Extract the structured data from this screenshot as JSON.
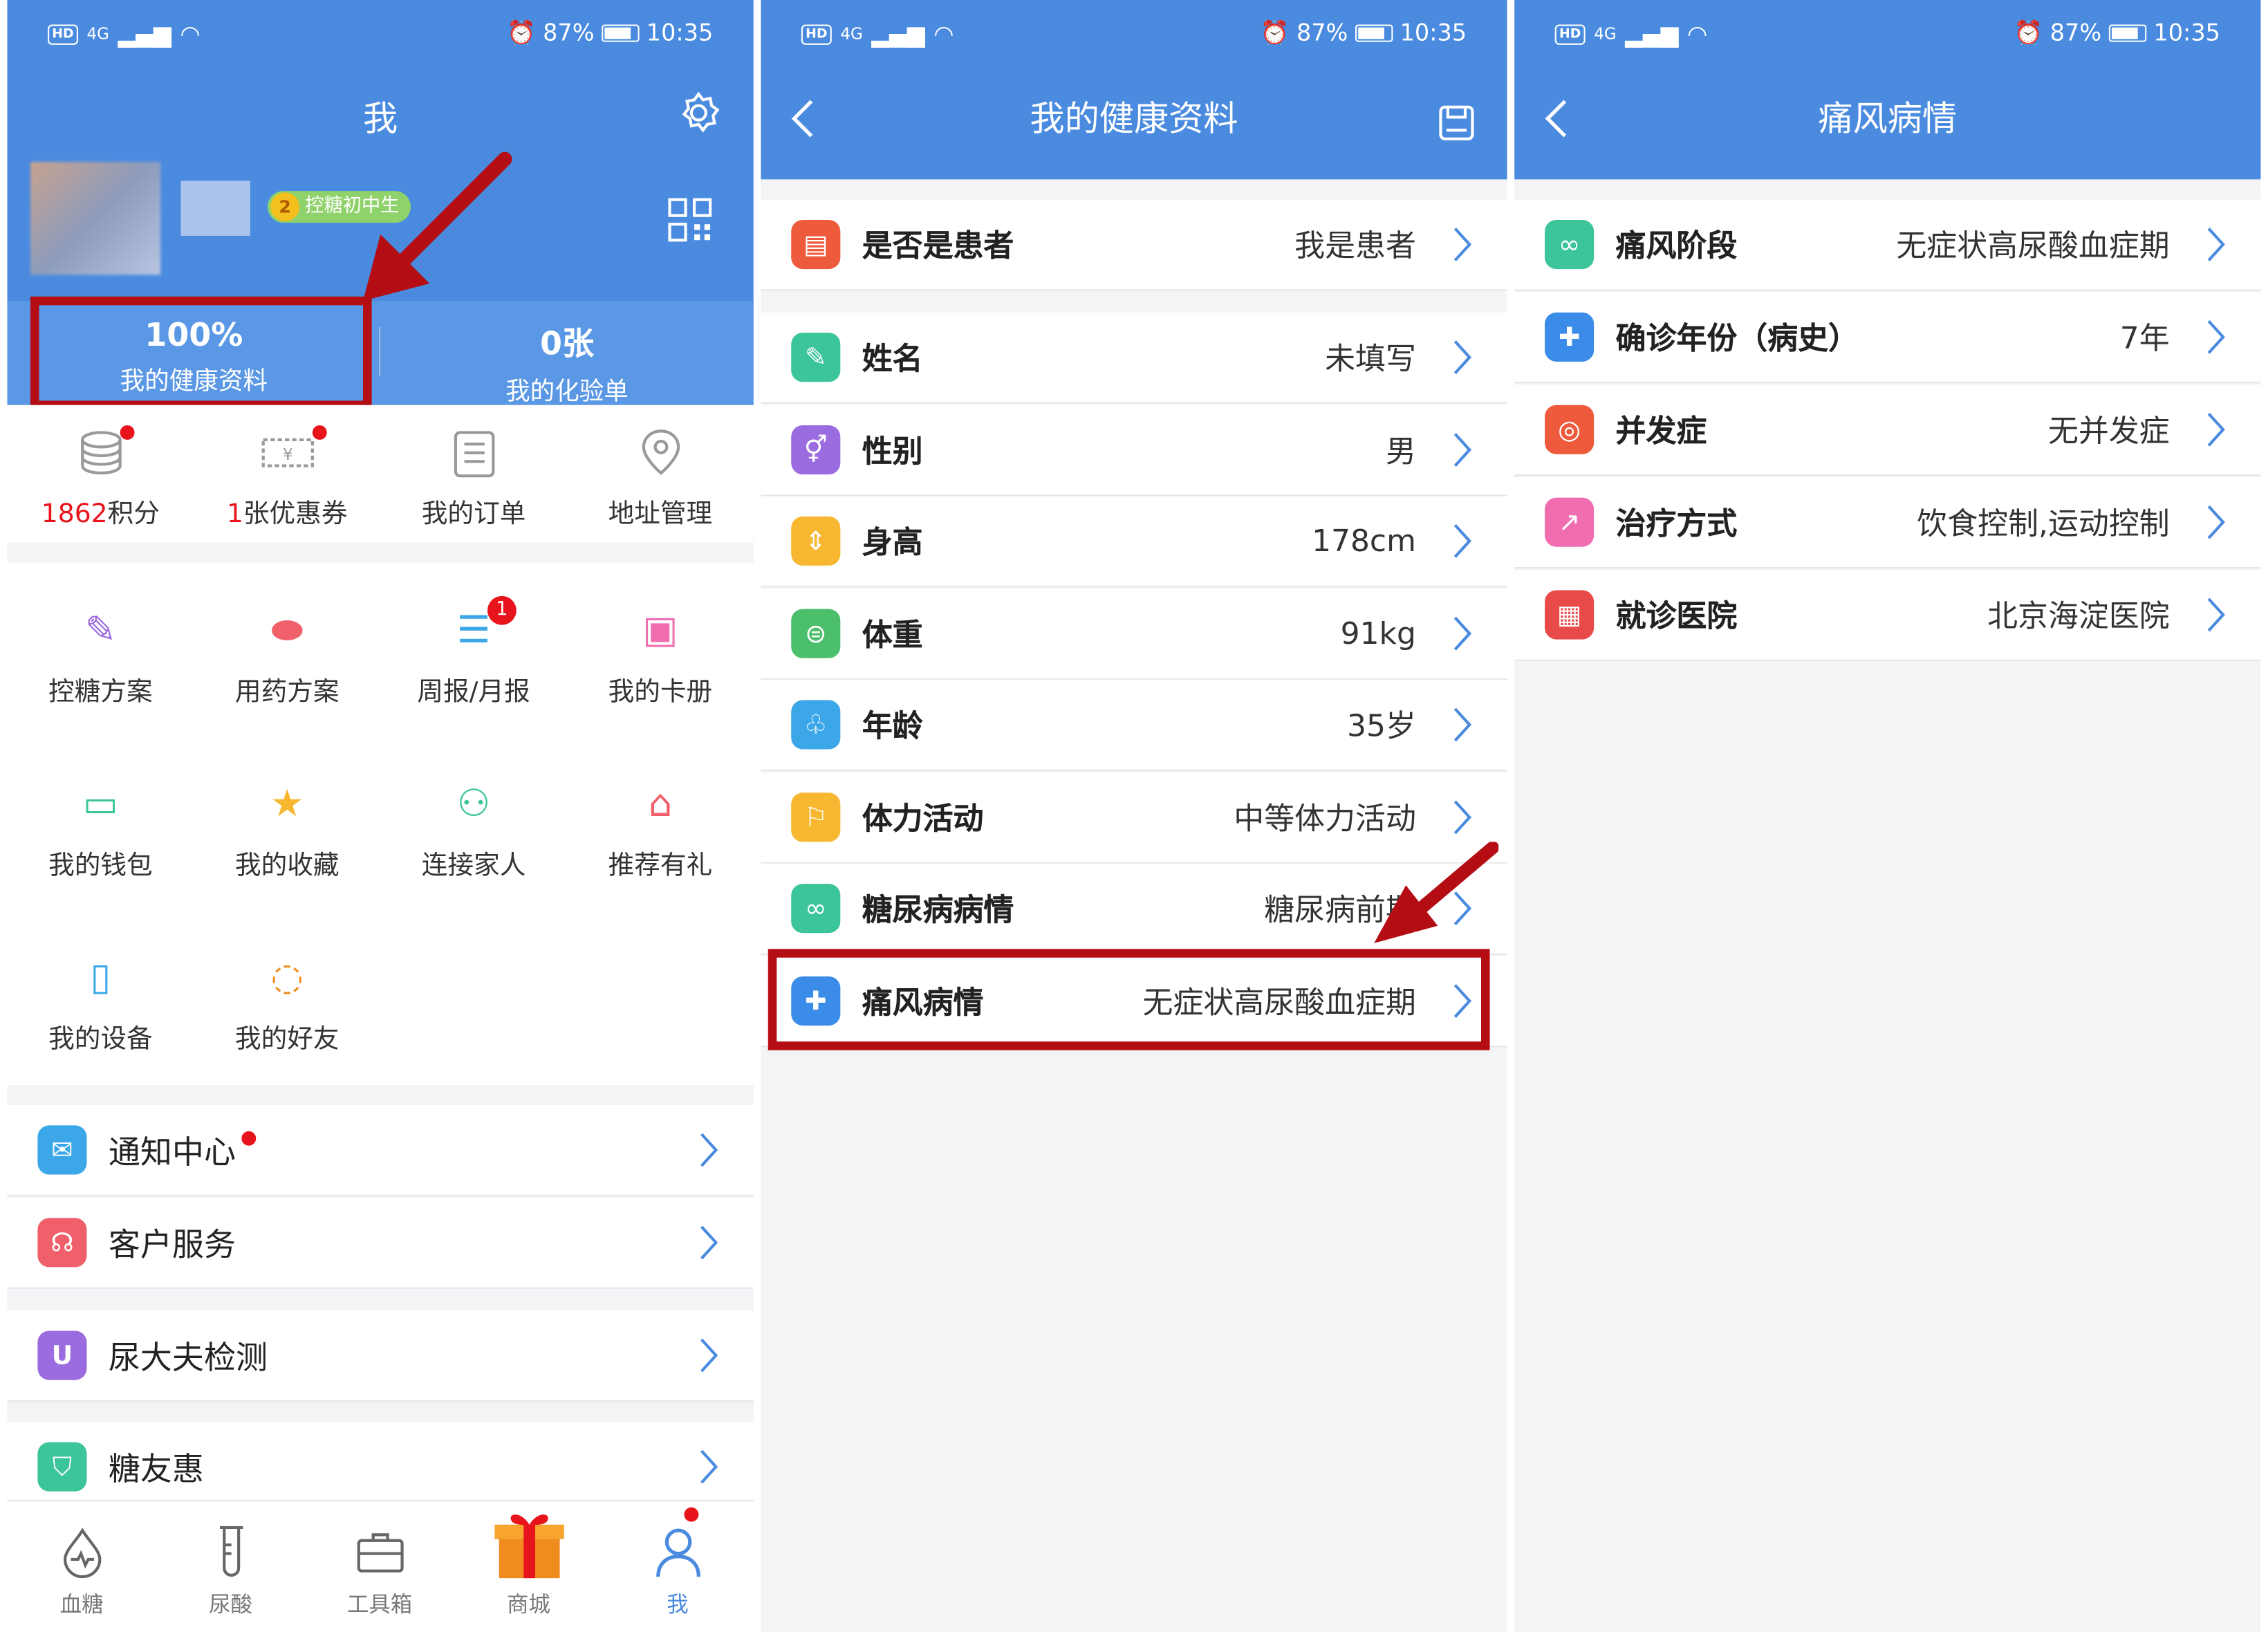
{
  "status": {
    "signal": "4G",
    "alarm_battery": "87%",
    "time": "10:35",
    "hd": "HD"
  },
  "panel1": {
    "title": "我",
    "badge": "控糖初中生",
    "badge_level": "2",
    "stats": [
      {
        "value": "100%",
        "label": "我的健康资料"
      },
      {
        "value": "0张",
        "label": "我的化验单"
      }
    ],
    "quick": [
      {
        "num": "1862",
        "label": "积分",
        "icon": "coins-icon"
      },
      {
        "num": "1",
        "label": "张优惠券",
        "icon": "coupon-icon"
      },
      {
        "num": "",
        "label": "我的订单",
        "icon": "order-icon"
      },
      {
        "num": "",
        "label": "地址管理",
        "icon": "location-icon"
      }
    ],
    "grid": [
      {
        "label": "控糖方案",
        "icon": "edit-icon"
      },
      {
        "label": "用药方案",
        "icon": "pill-icon"
      },
      {
        "label": "周报/月报",
        "icon": "report-icon",
        "badge": "1"
      },
      {
        "label": "我的卡册",
        "icon": "cards-icon"
      },
      {
        "label": "我的钱包",
        "icon": "wallet-icon"
      },
      {
        "label": "我的收藏",
        "icon": "star-icon"
      },
      {
        "label": "连接家人",
        "icon": "family-icon"
      },
      {
        "label": "推荐有礼",
        "icon": "gift-icon"
      },
      {
        "label": "我的设备",
        "icon": "device-icon"
      },
      {
        "label": "我的好友",
        "icon": "chat-icon"
      }
    ],
    "list": [
      {
        "label": "通知中心",
        "icon": "mail-icon",
        "color": "#3ba7e8"
      },
      {
        "label": "客户服务",
        "icon": "headset-icon",
        "color": "#f0606a"
      },
      {
        "label": "尿大夫检测",
        "icon": "test-icon",
        "color": "#9b6be0"
      },
      {
        "label": "糖友惠",
        "icon": "bag-icon",
        "color": "#3cc49a"
      }
    ],
    "tabs": [
      {
        "label": "血糖",
        "icon": "blood-drop-icon"
      },
      {
        "label": "尿酸",
        "icon": "test-tube-icon"
      },
      {
        "label": "工具箱",
        "icon": "toolbox-icon"
      },
      {
        "label": "商城",
        "icon": "gift-box-icon"
      },
      {
        "label": "我",
        "icon": "person-icon"
      }
    ],
    "colors": {
      "primary": "#4a8be0",
      "red": "#e8141c",
      "accent_box": "#b50d14"
    }
  },
  "panel2": {
    "title": "我的健康资料",
    "rows": [
      {
        "label": "是否是患者",
        "value": "我是患者",
        "color": "#ee5a3c",
        "icon": "clipboard-icon"
      },
      {
        "label": "姓名",
        "value": "未填写",
        "color": "#3cc49a",
        "icon": "edit-icon"
      },
      {
        "label": "性别",
        "value": "男",
        "color": "#9b6be0",
        "icon": "gender-icon"
      },
      {
        "label": "身高",
        "value": "178cm",
        "color": "#f7b731",
        "icon": "height-icon"
      },
      {
        "label": "体重",
        "value": "91kg",
        "color": "#4cbf6c",
        "icon": "scale-icon"
      },
      {
        "label": "年龄",
        "value": "35岁",
        "color": "#3ba7e8",
        "icon": "tree-icon"
      },
      {
        "label": "体力活动",
        "value": "中等体力活动",
        "color": "#f7b731",
        "icon": "run-icon"
      },
      {
        "label": "糖尿病病情",
        "value": "糖尿病前期",
        "color": "#3cc49a",
        "icon": "cells-icon"
      },
      {
        "label": "痛风病情",
        "value": "无症状高尿酸血症期",
        "color": "#3b8be8",
        "icon": "medical-icon"
      }
    ]
  },
  "panel3": {
    "title": "痛风病情",
    "rows": [
      {
        "label": "痛风阶段",
        "value": "无症状高尿酸血症期",
        "color": "#3cc49a",
        "icon": "cells-icon"
      },
      {
        "label": "确诊年份（病史）",
        "value": "7年",
        "color": "#3b8be8",
        "icon": "medical-icon"
      },
      {
        "label": "并发症",
        "value": "无并发症",
        "color": "#ee5a3c",
        "icon": "target-icon"
      },
      {
        "label": "治疗方式",
        "value": "饮食控制,运动控制",
        "color": "#f06eb0",
        "icon": "syringe-icon"
      },
      {
        "label": "就诊医院",
        "value": "北京海淀医院",
        "color": "#e84a4a",
        "icon": "hospital-icon"
      }
    ]
  }
}
